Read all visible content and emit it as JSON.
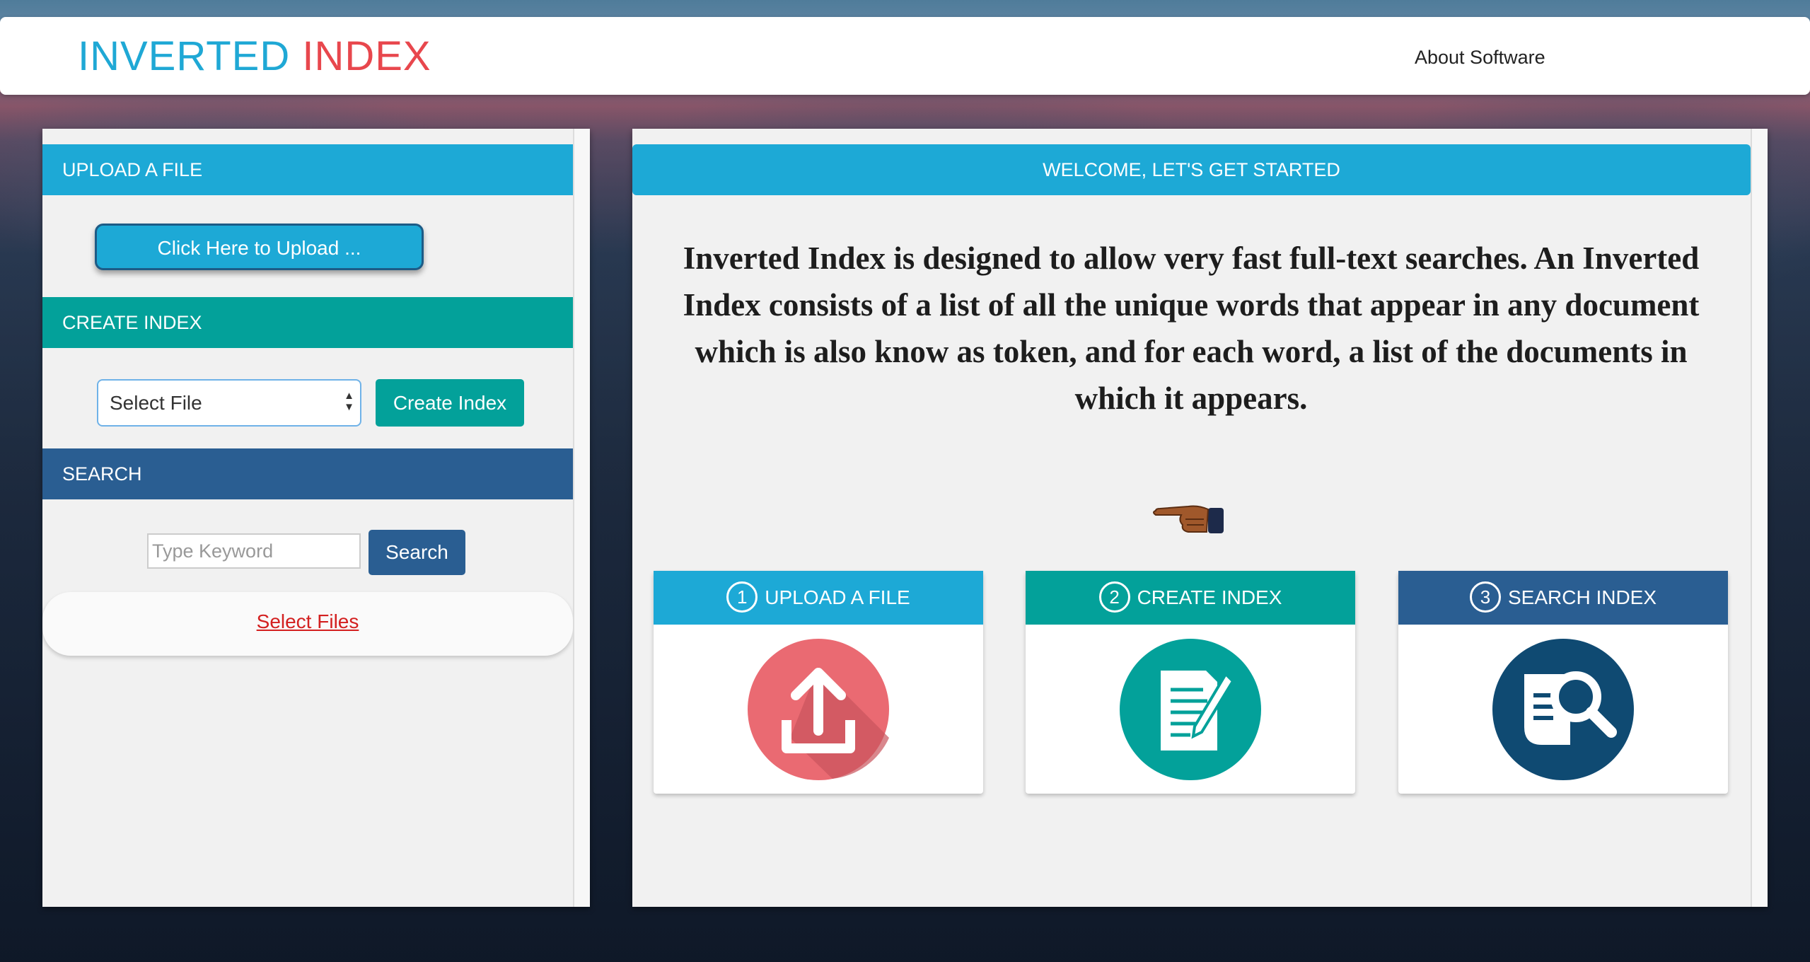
{
  "navbar": {
    "brand_part1": "INVERTED",
    "brand_part2": "INDEX",
    "about_link": "About Software"
  },
  "sidebar": {
    "upload_header": "UPLOAD A FILE",
    "upload_button": "Click Here to Upload ...",
    "create_header": "CREATE INDEX",
    "select_file_value": "Select File",
    "create_button": "Create Index",
    "search_header": "SEARCH",
    "keyword_placeholder": "Type Keyword",
    "search_button": "Search",
    "select_files_link": "Select Files"
  },
  "main": {
    "welcome_header": "WELCOME, LET'S GET STARTED",
    "intro_text": "Inverted Index is designed to allow very fast full-text searches. An Inverted Index consists of a list of all the unique words that appear in any document which is also know as token, and for each word, a list of the documents in which it appears.",
    "steps": [
      {
        "number": "1",
        "label": "UPLOAD A FILE",
        "icon": "upload-icon"
      },
      {
        "number": "2",
        "label": "CREATE INDEX",
        "icon": "document-edit-icon"
      },
      {
        "number": "3",
        "label": "SEARCH INDEX",
        "icon": "search-document-icon"
      }
    ]
  },
  "colors": {
    "brand_blue": "#1fa8d5",
    "brand_red": "#e8474d",
    "upload_blue": "#1da9d6",
    "create_teal": "#03a19a",
    "search_navy": "#2a5e92"
  }
}
